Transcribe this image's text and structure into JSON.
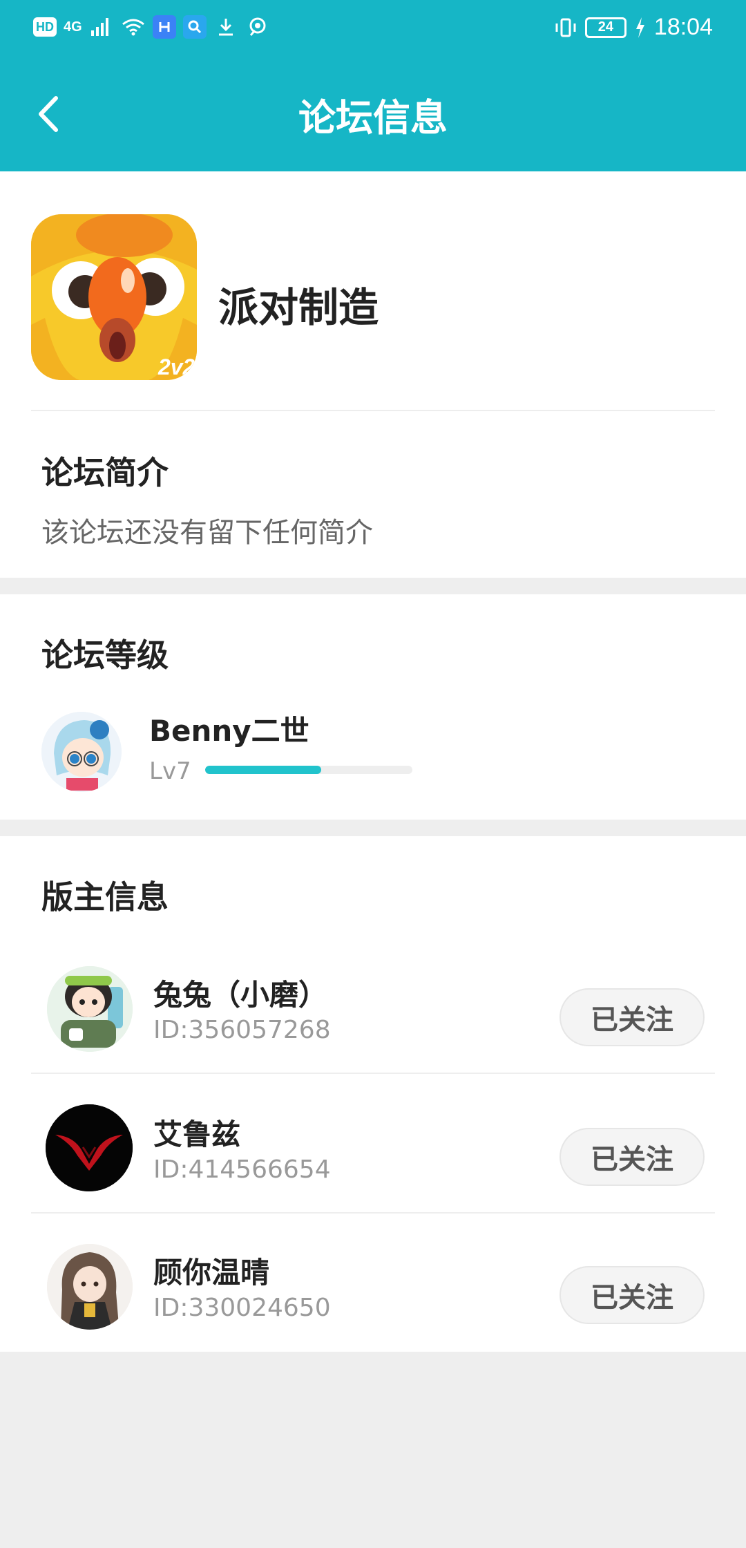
{
  "status_bar": {
    "left_labels": [
      "HD",
      "4G"
    ],
    "battery": "24",
    "time": "18:04"
  },
  "header": {
    "title": "论坛信息",
    "bg_color": "#16b6c6"
  },
  "forum": {
    "name": "派对制造",
    "icon_badge": "2v2",
    "intro_title": "论坛简介",
    "intro_text": "该论坛还没有留下任何简介"
  },
  "level": {
    "title": "论坛等级",
    "username": "Benny二世",
    "level_label": "Lv7",
    "progress": 0.56
  },
  "moderators": {
    "title": "版主信息",
    "items": [
      {
        "name": "兔兔（小磨）",
        "id": "ID:356057268",
        "button": "已关注"
      },
      {
        "name": "艾鲁兹",
        "id": "ID:414566654",
        "button": "已关注"
      },
      {
        "name": "顾你温晴",
        "id": "ID:330024650",
        "button": "已关注"
      }
    ]
  },
  "colors": {
    "accent": "#16b6c6",
    "progress": "#21c3cc",
    "muted_text": "#999999"
  }
}
